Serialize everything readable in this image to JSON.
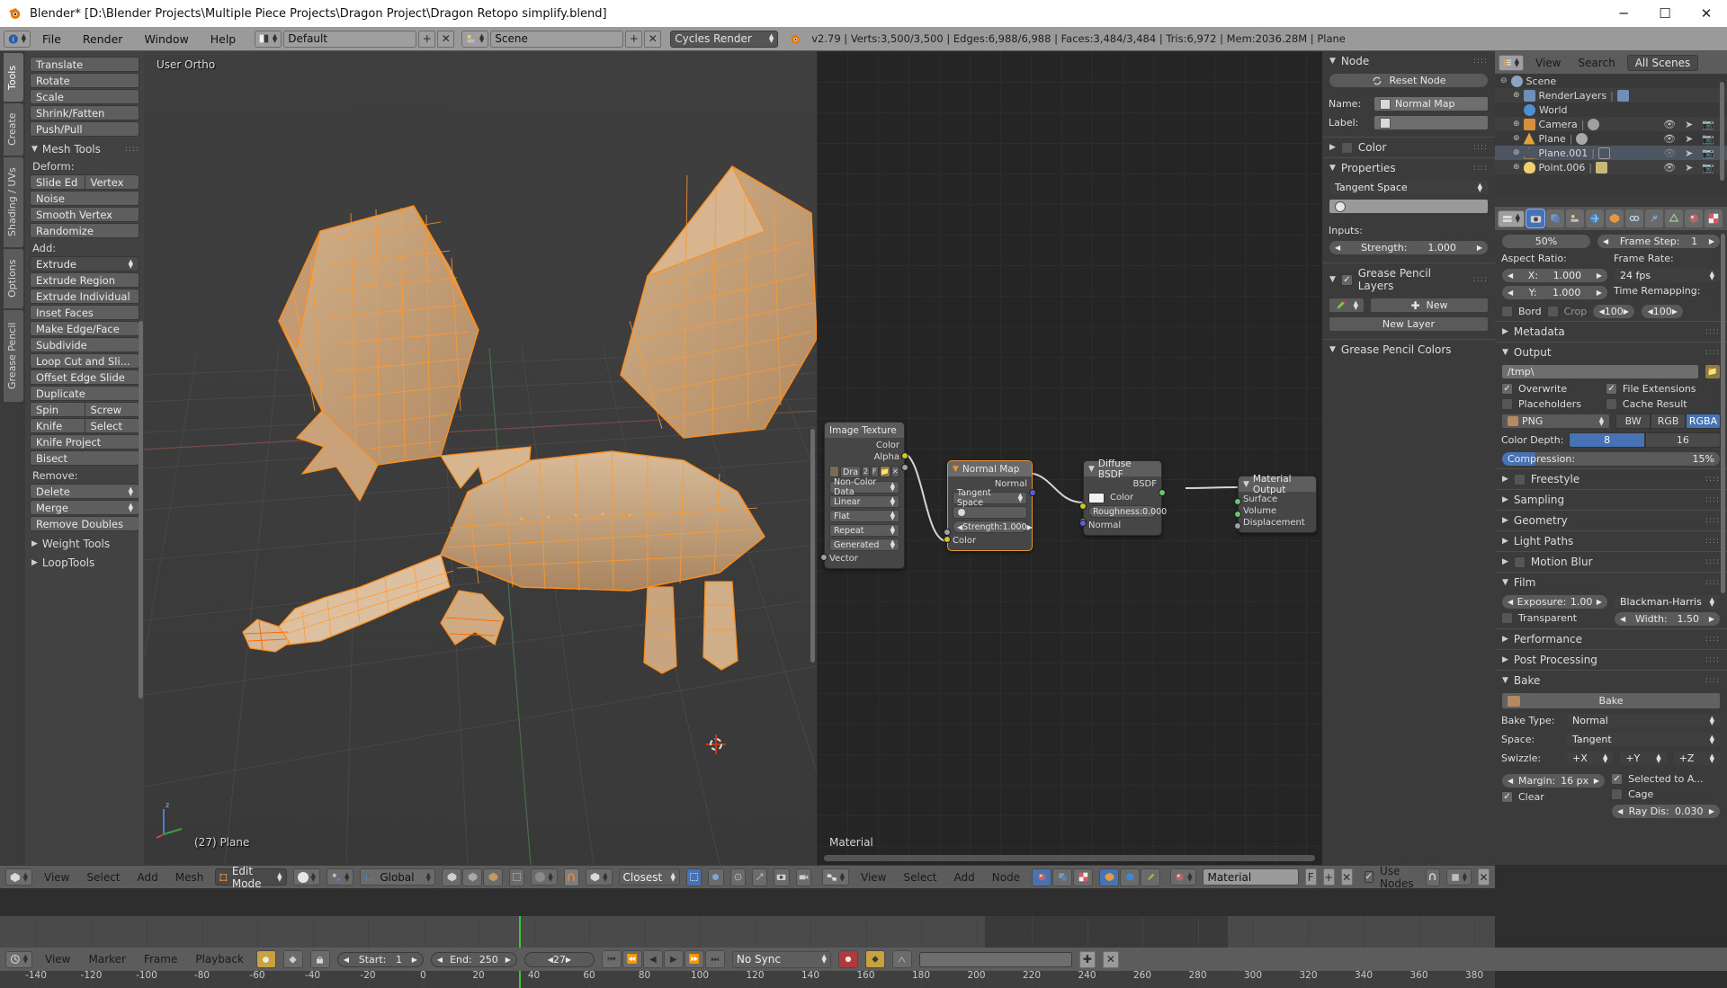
{
  "window": {
    "title": "Blender* [D:\\Blender Projects\\Multiple Piece Projects\\Dragon Project\\Dragon Retopo simplify.blend]",
    "minimize": "─",
    "maximize": "☐",
    "close": "✕"
  },
  "topbar": {
    "menus": [
      "File",
      "Render",
      "Window",
      "Help"
    ],
    "screen_layout": "Default",
    "scene": "Scene",
    "engine": "Cycles Render",
    "add_icon": "+",
    "remove_icon": "✕",
    "status": "v2.79 | Verts:3,500/3,500 | Edges:6,988/6,988 | Faces:3,484/3,484 | Tris:6,972 | Mem:2036.28M | Plane"
  },
  "toolshelf": {
    "tabs": [
      "Tools",
      "Create",
      "Shading / UVs",
      "Options",
      "Grease Pencil"
    ],
    "active_tab": "Tools",
    "transform_buttons": [
      "Translate",
      "Rotate",
      "Scale",
      "Shrink/Fatten",
      "Push/Pull"
    ],
    "mesh_tools_title": "Mesh Tools",
    "deform_label": "Deform:",
    "deform_pair": [
      "Slide Ed",
      "Vertex"
    ],
    "deform_buttons": [
      "Noise",
      "Smooth Vertex",
      "Randomize"
    ],
    "add_label": "Add:",
    "add_active": "Extrude",
    "add_buttons": [
      "Extrude Region",
      "Extrude Individual",
      "Inset Faces",
      "Make Edge/Face",
      "Subdivide",
      "Loop Cut and Sli...",
      "Offset Edge Slide",
      "Duplicate"
    ],
    "add_pair1": [
      "Spin",
      "Screw"
    ],
    "add_pair2": [
      "Knife",
      "Select"
    ],
    "add_buttons2": [
      "Knife Project",
      "Bisect"
    ],
    "remove_label": "Remove:",
    "remove_buttons": [
      "Delete",
      "Merge",
      "Remove Doubles"
    ],
    "collapsed_panels": [
      "Weight Tools",
      "LoopTools"
    ]
  },
  "viewport": {
    "view_label": "User Ortho",
    "object_label": "(27) Plane",
    "header": {
      "menus": [
        "View",
        "Select",
        "Add",
        "Mesh"
      ],
      "mode": "Edit Mode",
      "transform_orientation": "Global",
      "snap_target": "Closest"
    }
  },
  "node_editor": {
    "material_label": "Material",
    "header": {
      "menus": [
        "View",
        "Select",
        "Add",
        "Node"
      ],
      "material_name": "Material",
      "fake_user": "F",
      "add": "+",
      "remove": "✕",
      "use_nodes": "Use Nodes"
    },
    "nodes": [
      {
        "title": "Image Texture",
        "outputs": [
          "Color",
          "Alpha"
        ],
        "image_name": "Dra",
        "users": "2",
        "fake": "F",
        "fields": [
          "Non-Color Data",
          "Linear",
          "Flat",
          "Repeat",
          "Generated"
        ],
        "inputs": [
          "Vector"
        ]
      },
      {
        "title": "Normal Map",
        "outputs": [
          "Normal"
        ],
        "space": "Tangent Space",
        "uv_map": "",
        "strength_label": "Strength:",
        "strength_value": "1.000",
        "inputs": [
          "Color"
        ]
      },
      {
        "title": "Diffuse BSDF",
        "outputs": [
          "BSDF"
        ],
        "color_label": "Color",
        "roughness_label": "Roughness:",
        "roughness_value": "0.000",
        "inputs": [
          "Normal"
        ]
      },
      {
        "title": "Material Output",
        "inputs": [
          "Surface",
          "Volume",
          "Displacement"
        ]
      }
    ]
  },
  "outliner": {
    "menus": [
      "View",
      "Search"
    ],
    "display_mode": "All Scenes",
    "rows": [
      {
        "label": "Scene",
        "indent": 0,
        "icon": "scene-icon",
        "expander": "−"
      },
      {
        "label": "RenderLayers",
        "indent": 1,
        "icon": "renderlayers-icon",
        "expander": "+"
      },
      {
        "label": "World",
        "indent": 1,
        "icon": "world-icon",
        "expander": ""
      },
      {
        "label": "Camera",
        "indent": 1,
        "icon": "camera-icon",
        "expander": "+"
      },
      {
        "label": "Plane",
        "indent": 1,
        "icon": "mesh-icon",
        "expander": "+"
      },
      {
        "label": "Plane.001",
        "indent": 1,
        "icon": "mesh-icon",
        "expander": "+",
        "selected": true
      },
      {
        "label": "Point.006",
        "indent": 1,
        "icon": "light-icon",
        "expander": "+"
      }
    ]
  },
  "node_properties": {
    "panel_node_title": "Node",
    "reset_node": "Reset Node",
    "name_label": "Name:",
    "name_value": "Normal Map",
    "label_label": "Label:",
    "label_value": "",
    "color_title": "Color",
    "properties_title": "Properties",
    "space_value": "Tangent Space",
    "uv_value": "",
    "inputs_label": "Inputs:",
    "strength_label": "Strength:",
    "strength_value": "1.000",
    "grease_pencil_layers_title": "Grease Pencil Layers",
    "new_button": "New",
    "new_layer_button": "New Layer",
    "grease_pencil_colors_title": "Grease Pencil Colors"
  },
  "render_properties": {
    "percentage": "50%",
    "frame_step_label": "Frame Step:",
    "frame_step_value": "1",
    "aspect_ratio_label": "Aspect Ratio:",
    "aspect_x_label": "X:",
    "aspect_x_value": "1.000",
    "aspect_y_label": "Y:",
    "aspect_y_value": "1.000",
    "frame_rate_label": "Frame Rate:",
    "frame_rate_value": "24 fps",
    "time_remapping_label": "Time Remapping:",
    "time_remap_old": "100",
    "time_remap_new": "100",
    "border_label": "Bord",
    "crop_label": "Crop",
    "metadata_title": "Metadata",
    "output_title": "Output",
    "output_path": "/tmp\\",
    "overwrite": "Overwrite",
    "file_extensions": "File Extensions",
    "placeholders": "Placeholders",
    "cache_result": "Cache Result",
    "file_format": "PNG",
    "color_modes": [
      "BW",
      "RGB",
      "RGBA"
    ],
    "color_mode_active": "RGBA",
    "color_depth_label": "Color Depth:",
    "color_depths": [
      "8",
      "16"
    ],
    "color_depth_active": "8",
    "compression_label": "Compression:",
    "compression_value": "15%",
    "sections": [
      "Freestyle",
      "Sampling",
      "Geometry",
      "Light Paths",
      "Motion Blur"
    ],
    "film_title": "Film",
    "exposure_label": "Exposure:",
    "exposure_value": "1.00",
    "filter_type": "Blackman-Harris",
    "width_label": "Width:",
    "width_value": "1.50",
    "transparent_label": "Transparent",
    "sections2": [
      "Performance",
      "Post Processing"
    ],
    "bake_title": "Bake",
    "bake_button": "Bake",
    "bake_type_label": "Bake Type:",
    "bake_type_value": "Normal",
    "space_label": "Space:",
    "space_value": "Tangent",
    "swizzle_label": "Swizzle:",
    "swizzle": [
      "+X",
      "+Y",
      "+Z"
    ],
    "margin_label": "Margin:",
    "margin_value": "16 px",
    "selected_to_active": "Selected to A...",
    "clear_label": "Clear",
    "cage_label": "Cage",
    "ray_distance_label": "Ray Dis:",
    "ray_distance_value": "0.030"
  },
  "timeline": {
    "ticks": [
      "-140",
      "-120",
      "-100",
      "-80",
      "-60",
      "-40",
      "-20",
      "0",
      "20",
      "40",
      "60",
      "80",
      "100",
      "120",
      "140",
      "160",
      "180",
      "200",
      "220",
      "240",
      "260",
      "280",
      "300",
      "320",
      "340",
      "360",
      "380"
    ],
    "menus": [
      "View",
      "Marker",
      "Frame",
      "Playback"
    ],
    "start_label": "Start:",
    "start_value": "1",
    "end_label": "End:",
    "end_value": "250",
    "current_frame": "27",
    "sync_mode": "No Sync"
  },
  "colors": {
    "accent_blue": "#4772b3",
    "mesh_orange": "#ff9f3f",
    "header_grey": "#5c5c5c",
    "panel_grey": "#3b3b3b",
    "node_bg": "#252525"
  }
}
